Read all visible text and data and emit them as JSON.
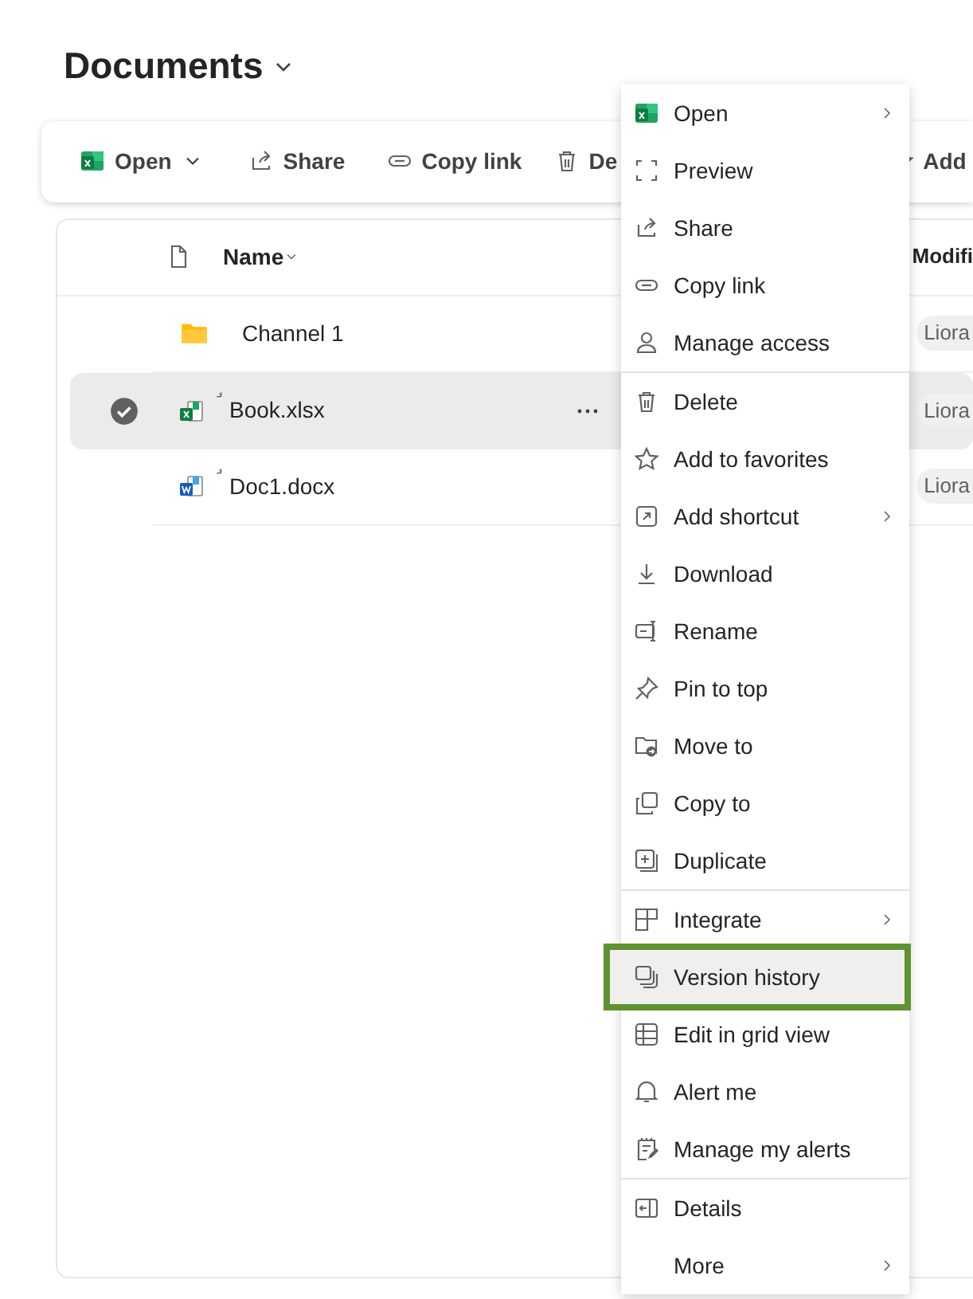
{
  "library": {
    "title": "Documents"
  },
  "toolbar": [
    {
      "label": "Open",
      "kind": "open"
    },
    {
      "label": "Share",
      "kind": "share"
    },
    {
      "label": "Copy link",
      "kind": "link"
    },
    {
      "label": "De",
      "kind": "delete"
    },
    {
      "label": "Add",
      "kind": "star"
    }
  ],
  "table": {
    "columns": [
      "Name",
      "Modifi"
    ],
    "rows": [
      {
        "kind": "folder",
        "name": "Channel 1",
        "new": false,
        "selected": false,
        "modified_by": "Liora"
      },
      {
        "kind": "excel",
        "name": "Book.xlsx",
        "new": true,
        "selected": true,
        "modified_by": "Liora"
      },
      {
        "kind": "word",
        "name": "Doc1.docx",
        "new": true,
        "selected": false,
        "modified_by": "Liora"
      }
    ]
  },
  "context_menu": {
    "groups": [
      [
        {
          "label": "Open",
          "submenu": true,
          "highlighted": false
        },
        {
          "label": "Preview",
          "submenu": false,
          "highlighted": false
        },
        {
          "label": "Share",
          "submenu": false,
          "highlighted": false
        },
        {
          "label": "Copy link",
          "submenu": false,
          "highlighted": false
        },
        {
          "label": "Manage access",
          "submenu": false,
          "highlighted": false
        }
      ],
      [
        {
          "label": "Delete",
          "submenu": false,
          "highlighted": false
        },
        {
          "label": "Add to favorites",
          "submenu": false,
          "highlighted": false
        },
        {
          "label": "Add shortcut",
          "submenu": true,
          "highlighted": false
        },
        {
          "label": "Download",
          "submenu": false,
          "highlighted": false
        },
        {
          "label": "Rename",
          "submenu": false,
          "highlighted": false
        },
        {
          "label": "Pin to top",
          "submenu": false,
          "highlighted": false
        },
        {
          "label": "Move to",
          "submenu": false,
          "highlighted": false
        },
        {
          "label": "Copy to",
          "submenu": false,
          "highlighted": false
        },
        {
          "label": "Duplicate",
          "submenu": false,
          "highlighted": false
        }
      ],
      [
        {
          "label": "Integrate",
          "submenu": true,
          "highlighted": false
        },
        {
          "label": "Version history",
          "submenu": false,
          "highlighted": true
        },
        {
          "label": "Edit in grid view",
          "submenu": false,
          "highlighted": false
        },
        {
          "label": "Alert me",
          "submenu": false,
          "highlighted": false
        },
        {
          "label": "Manage my alerts",
          "submenu": false,
          "highlighted": false
        }
      ],
      [
        {
          "label": "Details",
          "submenu": false,
          "highlighted": false
        },
        {
          "label": "More",
          "submenu": true,
          "highlighted": false
        }
      ]
    ]
  }
}
